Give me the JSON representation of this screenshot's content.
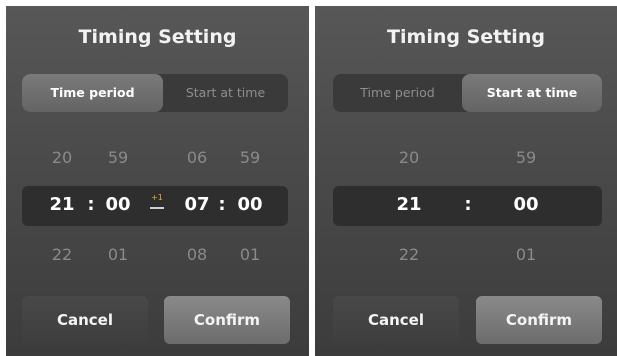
{
  "left_panel": {
    "title": "Timing Setting",
    "tabs": [
      "Time period",
      "Start at time"
    ],
    "active_tab": "Time period",
    "start": {
      "hour_prev": "20",
      "hour": "21",
      "hour_next": "22",
      "min_prev": "59",
      "min": "00",
      "min_next": "01"
    },
    "end": {
      "hour_prev": "06",
      "hour": "07",
      "hour_next": "08",
      "min_prev": "59",
      "min": "00",
      "min_next": "01"
    },
    "separator": ":",
    "next_day_badge": "+1",
    "cancel_label": "Cancel",
    "confirm_label": "Confirm"
  },
  "right_panel": {
    "title": "Timing Setting",
    "tabs": [
      "Time period",
      "Start at time"
    ],
    "active_tab": "Start at time",
    "time": {
      "hour_prev": "20",
      "hour": "21",
      "hour_next": "22",
      "min_prev": "59",
      "min": "00",
      "min_next": "01"
    },
    "separator": ":",
    "cancel_label": "Cancel",
    "confirm_label": "Confirm"
  },
  "colors": {
    "panel_bg": "#4a4a4a",
    "selection_bar": "#2e2e2e",
    "accent_badge": "#e0b02a",
    "confirm_bg": "#7c7c7c"
  }
}
